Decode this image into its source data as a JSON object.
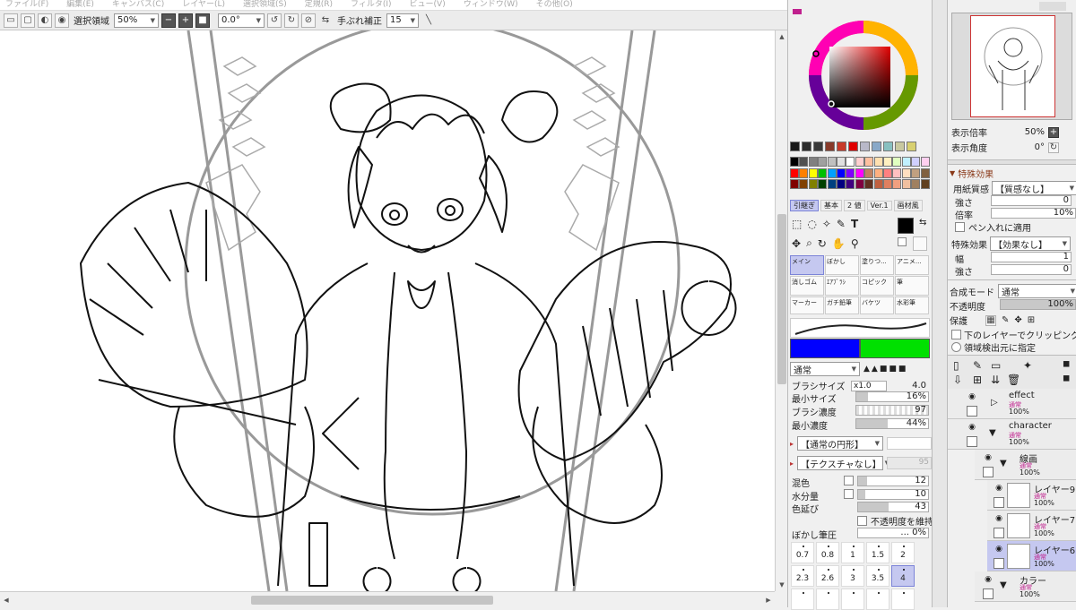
{
  "menubar": [
    "ファイル(F)",
    "編集(E)",
    "キャンバス(C)",
    "レイヤー(L)",
    "選択領域(S)",
    "定規(R)",
    "フィルタ(I)",
    "ビュー(V)",
    "ウィンドウ(W)",
    "その他(O)"
  ],
  "toolbar": {
    "selection_label": "選択領域",
    "zoom": "50%",
    "angle": "0.0°",
    "stabilizer_label": "手ぶれ補正",
    "stabilizer_value": "15"
  },
  "colors": {
    "palette_row1": [
      "#1a1a1a",
      "#2a2a2a",
      "#3a3a3a",
      "#883a2a",
      "#c83a2a",
      "#e00000",
      "#b8b8c8",
      "#88a8c8",
      "#88c0c0",
      "#c8c8a0",
      "#d8d070"
    ],
    "palette_rows": [
      [
        "#000000",
        "#505050",
        "#808080",
        "#a0a0a0",
        "#c0c0c0",
        "#e0e0e0",
        "#ffffff",
        "#ffd0d0",
        "#ffc0a0",
        "#ffe0b0",
        "#fff0c0",
        "#e0ffc0",
        "#c0f0ff",
        "#d0d0ff",
        "#ffd0f0"
      ],
      [
        "#ff0000",
        "#ff8000",
        "#ffff00",
        "#00c000",
        "#00a0ff",
        "#0000ff",
        "#8000ff",
        "#ff00ff",
        "#c08060",
        "#ffb080",
        "#ff8080",
        "#ffc0c0",
        "#ffe0c0",
        "#c0a080",
        "#806040"
      ],
      [
        "#800000",
        "#804000",
        "#808000",
        "#004000",
        "#004080",
        "#000080",
        "#400080",
        "#800040",
        "#603020",
        "#c06040",
        "#e08060",
        "#f0a080",
        "#f0c0a0",
        "#a08060",
        "#604020"
      ]
    ],
    "primary": "#000000",
    "gradient_left": "#0000ff",
    "gradient_right": "#00e000"
  },
  "tool_tabs": [
    "引継ぎ",
    "基本",
    "2 値",
    "Ver.1",
    "画材風"
  ],
  "brushes": [
    "メイン",
    "ぼかし",
    "塗りつ...",
    "アニメ...",
    "消しゴム",
    "ｴｱﾌﾞﾗｼ",
    "コピック",
    "筆",
    "マーカー",
    "ガチ鉛筆",
    "バケツ",
    "水彩筆"
  ],
  "brush_settings": {
    "blend_mode": "通常",
    "brush_size_label": "ブラシサイズ",
    "brush_size_mult": "x1.0",
    "brush_size": "4.0",
    "min_size_label": "最小サイズ",
    "min_size": "16%",
    "min_size_frac": 0.16,
    "density_label": "ブラシ濃度",
    "density": "97",
    "min_density_label": "最小濃度",
    "min_density": "44%",
    "min_density_frac": 0.44,
    "shape": "【通常の円形】",
    "texture": "【テクスチャなし】",
    "texture_value": "95",
    "mix_label": "混色",
    "mix": "12",
    "water_label": "水分量",
    "water": "10",
    "stretch_label": "色延び",
    "stretch": "43",
    "keep_opacity": "不透明度を維持",
    "blur_label": "ぼかし筆圧",
    "blur": "... 0%"
  },
  "dot_sizes": [
    "0.7",
    "0.8",
    "1",
    "1.5",
    "2",
    "2.3",
    "2.6",
    "3",
    "3.5",
    "4"
  ],
  "navigator": {
    "zoom_label": "表示倍率",
    "zoom": "50%",
    "angle_label": "表示角度",
    "angle": "0°"
  },
  "effects": {
    "header": "特殊効果",
    "paper_label": "用紙質感",
    "paper": "【質感なし】",
    "strength_label": "強さ",
    "strength": "0",
    "scale_label": "倍率",
    "scale": "10%",
    "pen_apply": "ペン入れに適用",
    "effect_label": "特殊効果",
    "effect": "【効果なし】",
    "width_label": "幅",
    "width": "1",
    "strength2_label": "強さ",
    "strength2": "0"
  },
  "layer_props": {
    "blend_label": "合成モード",
    "blend": "通常",
    "opacity_label": "不透明度",
    "opacity": "100%",
    "protect_label": "保護",
    "clip": "下のレイヤーでクリッピング",
    "source": "領域検出元に指定"
  },
  "layers": [
    {
      "name": "effect",
      "mode": "通常",
      "opacity": "100%"
    },
    {
      "name": "character",
      "mode": "通常",
      "opacity": "100%"
    },
    {
      "name": "線画",
      "mode": "通常",
      "opacity": "100%"
    },
    {
      "name": "レイヤー9",
      "mode": "通常",
      "opacity": "100%"
    },
    {
      "name": "レイヤー7",
      "mode": "通常",
      "opacity": "100%"
    },
    {
      "name": "レイヤー6",
      "mode": "通常",
      "opacity": "100%"
    },
    {
      "name": "カラー",
      "mode": "通常",
      "opacity": "100%"
    }
  ]
}
